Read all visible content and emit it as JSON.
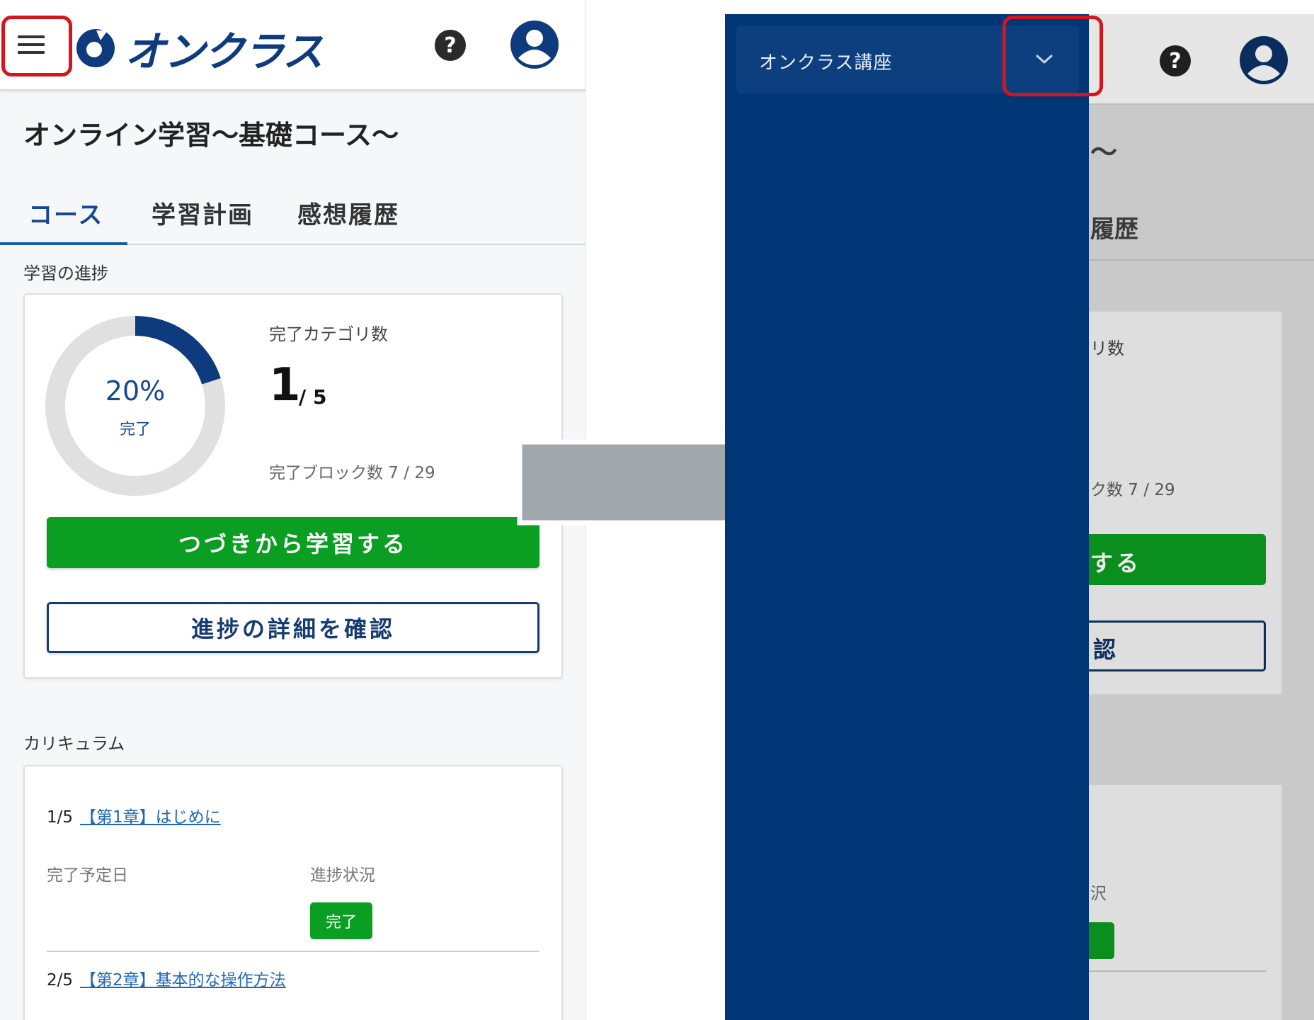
{
  "left": {
    "logo_text": "オンクラス",
    "help_glyph": "?",
    "page_title": "オンライン学習〜基礎コース〜",
    "tabs": [
      {
        "label": "コース",
        "active": true
      },
      {
        "label": "学習計画",
        "active": false
      },
      {
        "label": "感想履歴",
        "active": false
      }
    ],
    "progress_section_label": "学習の進捗",
    "progress": {
      "percent_label": "20%",
      "percent_value": 0.2,
      "done_label": "完了",
      "category_label": "完了カテゴリ数",
      "category_done": "1",
      "category_total": "/ 5",
      "blocks_text": "完了ブロック数 7 / 29"
    },
    "continue_button": "つづきから学習する",
    "detail_button": "進捗の詳細を確認",
    "curriculum_label": "カリキュラム",
    "chapters": [
      {
        "index": "1/5",
        "title": "【第1章】はじめに"
      },
      {
        "index": "2/5",
        "title": "【第2章】基本的な操作方法"
      }
    ],
    "due_label": "完了予定日",
    "status_label": "進捗状況",
    "status_badge": "完了"
  },
  "right": {
    "drawer_select_label": "オンクラス講座",
    "bg_fragments": {
      "title_tail": "〜",
      "tab_tail": "履歴",
      "category_tail": "リ数",
      "blocks_tail": "ク数 7 / 29",
      "continue_tail": "する",
      "detail_tail": "認",
      "status_tail": "沢"
    }
  },
  "colors": {
    "brand_blue": "#0e3a7e",
    "drawer_blue": "#003676",
    "green": "#0a9e22",
    "highlight_red": "#d7141c",
    "arrow_gray": "#a0a7ad"
  },
  "icons": [
    "hamburger-icon",
    "logo-mark-icon",
    "help-icon",
    "user-icon",
    "chevron-down-icon",
    "right-arrow-icon"
  ]
}
